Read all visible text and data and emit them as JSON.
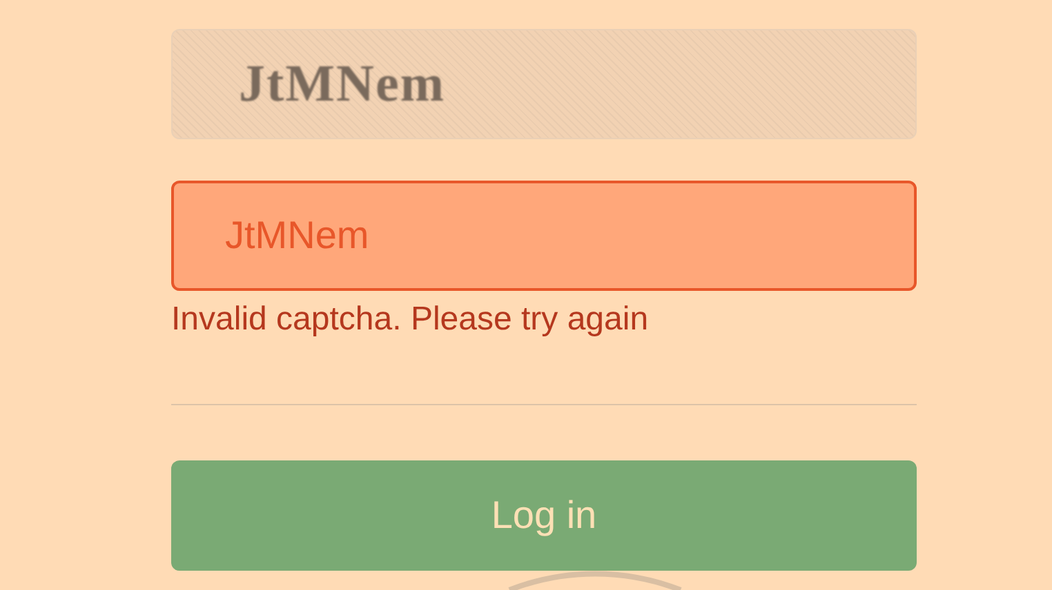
{
  "captcha": {
    "text": "JtMNem"
  },
  "captcha_input": {
    "value": "JtMNem",
    "invalid": true
  },
  "error_message": "Invalid captcha. Please try again",
  "login_button": {
    "label": "Log in"
  }
}
